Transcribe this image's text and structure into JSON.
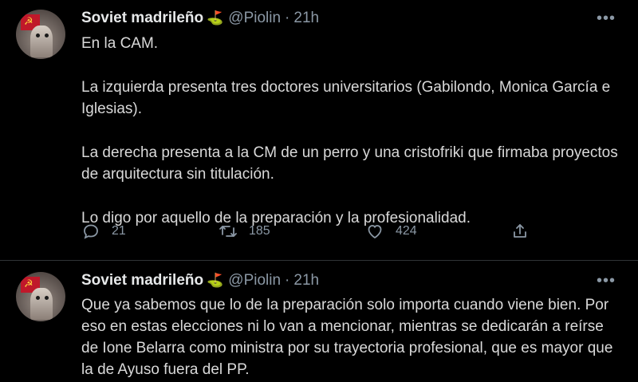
{
  "tweets": [
    {
      "author_name": "Soviet madrileño",
      "badge": "⛳",
      "handle": "@Piolin",
      "separator": "·",
      "time": "21h",
      "more": "•••",
      "paragraphs": [
        "En la CAM.",
        "La izquierda presenta tres doctores universitarios (Gabilondo, Monica García e Iglesias).",
        "La derecha presenta a la CM de un perro y una cristofriki que firmaba proyectos de arquitectura sin titulación.",
        "Lo digo por aquello de la preparación y la profesionalidad."
      ],
      "replies": "21",
      "retweets": "185",
      "likes": "424"
    },
    {
      "author_name": "Soviet madrileño",
      "badge": "⛳",
      "handle": "@Piolin",
      "separator": "·",
      "time": "21h",
      "more": "•••",
      "paragraphs": [
        "Que ya sabemos que lo de la preparación solo importa cuando viene bien. Por eso en estas elecciones ni lo van a mencionar, mientras se dedicarán a reírse de Ione Belarra como ministra por su trayectoria profesional, que es mayor que la de Ayuso fuera del PP."
      ]
    }
  ],
  "icons": {
    "reply": "reply-icon",
    "retweet": "retweet-icon",
    "like": "heart-icon",
    "share": "share-icon"
  },
  "colors": {
    "background": "#000000",
    "text": "#d9d9d9",
    "muted": "#8b98a5",
    "divider": "#2f3336"
  }
}
